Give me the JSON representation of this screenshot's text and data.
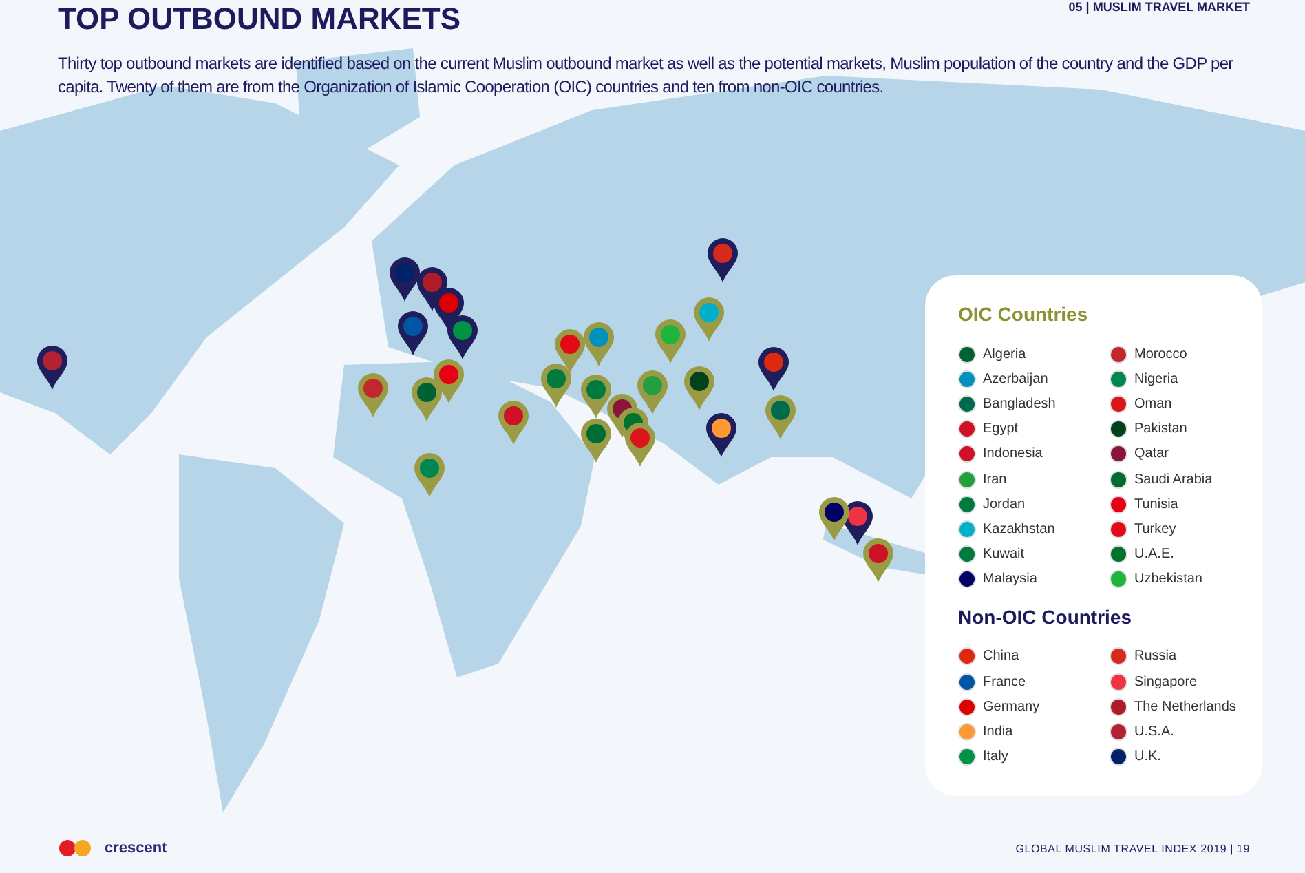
{
  "header": {
    "section": "05 | MUSLIM TRAVEL MARKET",
    "title": "TOP OUTBOUND MARKETS",
    "intro": "Thirty top outbound markets are identified based on the current Muslim outbound market as well as the potential markets, Muslim population of the country and the GDP per capita. Twenty of them are from the Organization of Islamic Cooperation (OIC) countries and ten from non-OIC countries."
  },
  "pins": [
    {
      "kind": "non_oic",
      "color": "#b22234"
    },
    {
      "kind": "non_oic",
      "color": "#012169"
    },
    {
      "kind": "non_oic",
      "color": "#ae1c28"
    },
    {
      "kind": "non_oic",
      "color": "#dd0000"
    },
    {
      "kind": "non_oic",
      "color": "#0055a4"
    },
    {
      "kind": "non_oic",
      "color": "#009246"
    },
    {
      "kind": "non_oic",
      "color": "#d52b1e"
    },
    {
      "kind": "non_oic",
      "color": "#de2910"
    },
    {
      "kind": "non_oic",
      "color": "#ff9933"
    },
    {
      "kind": "non_oic",
      "color": "#ef3340"
    },
    {
      "kind": "oic",
      "color": "#c1272d"
    },
    {
      "kind": "oic",
      "color": "#006233"
    },
    {
      "kind": "oic",
      "color": "#e70013"
    },
    {
      "kind": "oic",
      "color": "#ce1126"
    },
    {
      "kind": "oic",
      "color": "#e30a17"
    },
    {
      "kind": "oic",
      "color": "#0092bc"
    },
    {
      "kind": "oic",
      "color": "#007a3d"
    },
    {
      "kind": "oic",
      "color": "#007a3d"
    },
    {
      "kind": "oic",
      "color": "#006c35"
    },
    {
      "kind": "oic",
      "color": "#8a1538"
    },
    {
      "kind": "oic",
      "color": "#00732f"
    },
    {
      "kind": "oic",
      "color": "#db161b"
    },
    {
      "kind": "oic",
      "color": "#239f40"
    },
    {
      "kind": "oic",
      "color": "#1eb53a"
    },
    {
      "kind": "oic",
      "color": "#00afca"
    },
    {
      "kind": "oic",
      "color": "#01411c"
    },
    {
      "kind": "oic",
      "color": "#006a4e"
    },
    {
      "kind": "oic",
      "color": "#008751"
    },
    {
      "kind": "oic",
      "color": "#010066"
    },
    {
      "kind": "oic",
      "color": "#ce1126"
    }
  ],
  "legend": {
    "sections": [
      {
        "kind": "oic",
        "title": "OIC Countries",
        "items": [
          {
            "name": "Algeria",
            "color": "#006233"
          },
          {
            "name": "Azerbaijan",
            "color": "#0092bc"
          },
          {
            "name": "Bangladesh",
            "color": "#006a4e"
          },
          {
            "name": "Egypt",
            "color": "#ce1126"
          },
          {
            "name": "Indonesia",
            "color": "#ce1126"
          },
          {
            "name": "Iran",
            "color": "#239f40"
          },
          {
            "name": "Jordan",
            "color": "#007a3d"
          },
          {
            "name": "Kazakhstan",
            "color": "#00afca"
          },
          {
            "name": "Kuwait",
            "color": "#007a3d"
          },
          {
            "name": "Malaysia",
            "color": "#010066"
          },
          {
            "name": "Morocco",
            "color": "#c1272d"
          },
          {
            "name": "Nigeria",
            "color": "#008751"
          },
          {
            "name": "Oman",
            "color": "#db161b"
          },
          {
            "name": "Pakistan",
            "color": "#01411c"
          },
          {
            "name": "Qatar",
            "color": "#8a1538"
          },
          {
            "name": "Saudi Arabia",
            "color": "#006c35"
          },
          {
            "name": "Tunisia",
            "color": "#e70013"
          },
          {
            "name": "Turkey",
            "color": "#e30a17"
          },
          {
            "name": "U.A.E.",
            "color": "#00732f"
          },
          {
            "name": "Uzbekistan",
            "color": "#1eb53a"
          }
        ]
      },
      {
        "kind": "non_oic",
        "title": "Non-OIC Countries",
        "items": [
          {
            "name": "China",
            "color": "#de2910"
          },
          {
            "name": "France",
            "color": "#0055a4"
          },
          {
            "name": "Germany",
            "color": "#dd0000"
          },
          {
            "name": "India",
            "color": "#ff9933"
          },
          {
            "name": "Italy",
            "color": "#009246"
          },
          {
            "name": "Russia",
            "color": "#d52b1e"
          },
          {
            "name": "Singapore",
            "color": "#ef3340"
          },
          {
            "name": "The Netherlands",
            "color": "#ae1c28"
          },
          {
            "name": "U.S.A.",
            "color": "#b22234"
          },
          {
            "name": "U.K.",
            "color": "#012169"
          }
        ]
      }
    ]
  },
  "footer": {
    "brand": "crescent",
    "page": "GLOBAL MUSLIM TRAVEL INDEX 2019 | 19"
  }
}
